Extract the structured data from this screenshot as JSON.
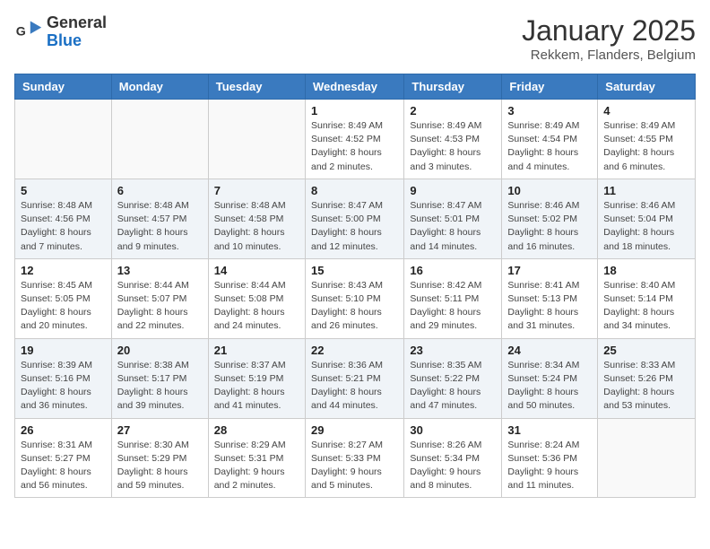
{
  "logo": {
    "general": "General",
    "blue": "Blue"
  },
  "header": {
    "month": "January 2025",
    "location": "Rekkem, Flanders, Belgium"
  },
  "weekdays": [
    "Sunday",
    "Monday",
    "Tuesday",
    "Wednesday",
    "Thursday",
    "Friday",
    "Saturday"
  ],
  "weeks": [
    [
      {
        "day": "",
        "info": ""
      },
      {
        "day": "",
        "info": ""
      },
      {
        "day": "",
        "info": ""
      },
      {
        "day": "1",
        "info": "Sunrise: 8:49 AM\nSunset: 4:52 PM\nDaylight: 8 hours\nand 2 minutes."
      },
      {
        "day": "2",
        "info": "Sunrise: 8:49 AM\nSunset: 4:53 PM\nDaylight: 8 hours\nand 3 minutes."
      },
      {
        "day": "3",
        "info": "Sunrise: 8:49 AM\nSunset: 4:54 PM\nDaylight: 8 hours\nand 4 minutes."
      },
      {
        "day": "4",
        "info": "Sunrise: 8:49 AM\nSunset: 4:55 PM\nDaylight: 8 hours\nand 6 minutes."
      }
    ],
    [
      {
        "day": "5",
        "info": "Sunrise: 8:48 AM\nSunset: 4:56 PM\nDaylight: 8 hours\nand 7 minutes."
      },
      {
        "day": "6",
        "info": "Sunrise: 8:48 AM\nSunset: 4:57 PM\nDaylight: 8 hours\nand 9 minutes."
      },
      {
        "day": "7",
        "info": "Sunrise: 8:48 AM\nSunset: 4:58 PM\nDaylight: 8 hours\nand 10 minutes."
      },
      {
        "day": "8",
        "info": "Sunrise: 8:47 AM\nSunset: 5:00 PM\nDaylight: 8 hours\nand 12 minutes."
      },
      {
        "day": "9",
        "info": "Sunrise: 8:47 AM\nSunset: 5:01 PM\nDaylight: 8 hours\nand 14 minutes."
      },
      {
        "day": "10",
        "info": "Sunrise: 8:46 AM\nSunset: 5:02 PM\nDaylight: 8 hours\nand 16 minutes."
      },
      {
        "day": "11",
        "info": "Sunrise: 8:46 AM\nSunset: 5:04 PM\nDaylight: 8 hours\nand 18 minutes."
      }
    ],
    [
      {
        "day": "12",
        "info": "Sunrise: 8:45 AM\nSunset: 5:05 PM\nDaylight: 8 hours\nand 20 minutes."
      },
      {
        "day": "13",
        "info": "Sunrise: 8:44 AM\nSunset: 5:07 PM\nDaylight: 8 hours\nand 22 minutes."
      },
      {
        "day": "14",
        "info": "Sunrise: 8:44 AM\nSunset: 5:08 PM\nDaylight: 8 hours\nand 24 minutes."
      },
      {
        "day": "15",
        "info": "Sunrise: 8:43 AM\nSunset: 5:10 PM\nDaylight: 8 hours\nand 26 minutes."
      },
      {
        "day": "16",
        "info": "Sunrise: 8:42 AM\nSunset: 5:11 PM\nDaylight: 8 hours\nand 29 minutes."
      },
      {
        "day": "17",
        "info": "Sunrise: 8:41 AM\nSunset: 5:13 PM\nDaylight: 8 hours\nand 31 minutes."
      },
      {
        "day": "18",
        "info": "Sunrise: 8:40 AM\nSunset: 5:14 PM\nDaylight: 8 hours\nand 34 minutes."
      }
    ],
    [
      {
        "day": "19",
        "info": "Sunrise: 8:39 AM\nSunset: 5:16 PM\nDaylight: 8 hours\nand 36 minutes."
      },
      {
        "day": "20",
        "info": "Sunrise: 8:38 AM\nSunset: 5:17 PM\nDaylight: 8 hours\nand 39 minutes."
      },
      {
        "day": "21",
        "info": "Sunrise: 8:37 AM\nSunset: 5:19 PM\nDaylight: 8 hours\nand 41 minutes."
      },
      {
        "day": "22",
        "info": "Sunrise: 8:36 AM\nSunset: 5:21 PM\nDaylight: 8 hours\nand 44 minutes."
      },
      {
        "day": "23",
        "info": "Sunrise: 8:35 AM\nSunset: 5:22 PM\nDaylight: 8 hours\nand 47 minutes."
      },
      {
        "day": "24",
        "info": "Sunrise: 8:34 AM\nSunset: 5:24 PM\nDaylight: 8 hours\nand 50 minutes."
      },
      {
        "day": "25",
        "info": "Sunrise: 8:33 AM\nSunset: 5:26 PM\nDaylight: 8 hours\nand 53 minutes."
      }
    ],
    [
      {
        "day": "26",
        "info": "Sunrise: 8:31 AM\nSunset: 5:27 PM\nDaylight: 8 hours\nand 56 minutes."
      },
      {
        "day": "27",
        "info": "Sunrise: 8:30 AM\nSunset: 5:29 PM\nDaylight: 8 hours\nand 59 minutes."
      },
      {
        "day": "28",
        "info": "Sunrise: 8:29 AM\nSunset: 5:31 PM\nDaylight: 9 hours\nand 2 minutes."
      },
      {
        "day": "29",
        "info": "Sunrise: 8:27 AM\nSunset: 5:33 PM\nDaylight: 9 hours\nand 5 minutes."
      },
      {
        "day": "30",
        "info": "Sunrise: 8:26 AM\nSunset: 5:34 PM\nDaylight: 9 hours\nand 8 minutes."
      },
      {
        "day": "31",
        "info": "Sunrise: 8:24 AM\nSunset: 5:36 PM\nDaylight: 9 hours\nand 11 minutes."
      },
      {
        "day": "",
        "info": ""
      }
    ]
  ]
}
